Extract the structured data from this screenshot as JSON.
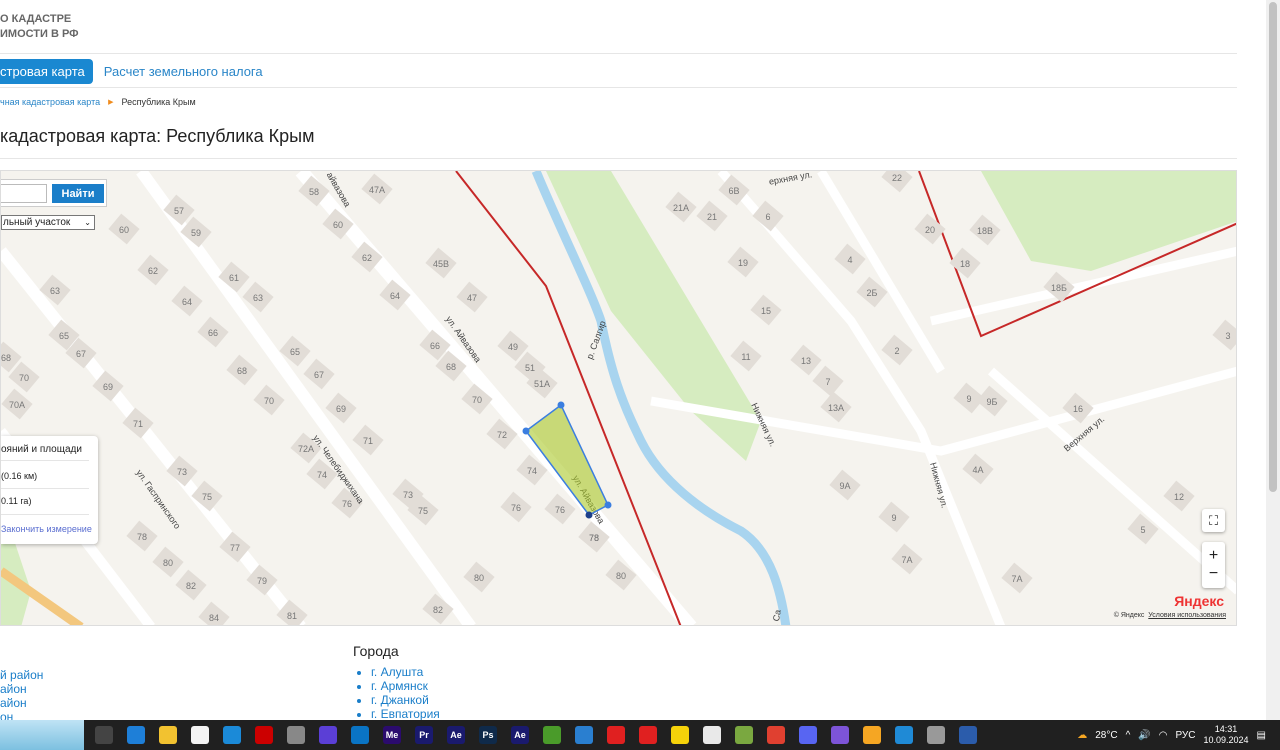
{
  "header": {
    "logo_line1": "О КАДАСТРЕ",
    "logo_line2": "ИМОСТИ В РФ"
  },
  "nav": {
    "active": "стровая карта",
    "tax": "Расчет земельного налога"
  },
  "breadcrumb": {
    "parent": "чная кадастровая карта",
    "current": "Республика Крым"
  },
  "page_title": "кадастровая карта: Республика Крым",
  "map": {
    "search_button": "Найти",
    "search_value": "",
    "type_select": "льный участок",
    "measure": {
      "title": "ояний и площади",
      "distance": "(0.16 км)",
      "area": "0.11 га)",
      "finish": "Закончить измерение"
    },
    "fullscreen": "⛶",
    "zoom_in": "+",
    "zoom_out": "−",
    "copyright": "© Яндекс",
    "terms": "Условия использования",
    "brand": "Яндекс",
    "streets": [
      "ул. Айвазова",
      "ул. Челебиджихана",
      "ул. Гаспринского",
      "Нижняя ул.",
      "Нижняя ул.",
      "Верхняя ул.",
      "ерхняя ул.",
      "р. Салгир",
      "ул. Айвазова",
      "р. Са",
      "айвазова"
    ],
    "buildings": [
      "57",
      "59",
      "60",
      "62",
      "63",
      "61",
      "63",
      "64",
      "66",
      "68",
      "65",
      "67",
      "69",
      "70",
      "71",
      "68",
      "70",
      "70А",
      "65",
      "67",
      "69",
      "71",
      "72А",
      "74",
      "76",
      "73",
      "75",
      "77",
      "78",
      "80",
      "79",
      "81",
      "82",
      "84",
      "73",
      "75",
      "76",
      "78",
      "80",
      "82",
      "58",
      "47А",
      "60",
      "62",
      "64",
      "45В",
      "47",
      "66",
      "68",
      "70",
      "72",
      "74",
      "76",
      "49",
      "51",
      "51А",
      "78",
      "80",
      "21А",
      "21",
      "6В",
      "6",
      "19",
      "15",
      "11",
      "13",
      "4",
      "2Б",
      "2",
      "7",
      "13А",
      "9",
      "9Б",
      "16",
      "22",
      "20",
      "18В",
      "18",
      "18Б",
      "9А",
      "9",
      "4А",
      "12",
      "5",
      "7А",
      "7А",
      "3"
    ]
  },
  "footer": {
    "districts": [
      "й район",
      "айон",
      "айон",
      "он"
    ],
    "cities_title": "Города",
    "cities": [
      "г. Алушта",
      "г. Армянск",
      "г. Джанкой",
      "г. Евпатория"
    ]
  },
  "taskbar": {
    "weather": "28°C",
    "lang": "РУС",
    "time": "14:31",
    "date": "10.09.2024",
    "apps": [
      "task-view",
      "edge",
      "explorer",
      "store",
      "mail",
      "s-app",
      "cloud",
      "vpn",
      "screen",
      "Me",
      "Pr",
      "Ae",
      "Ps",
      "Ae",
      "utorrent",
      "defender",
      "opera",
      "yandex",
      "beeline",
      "yandex-browser",
      "photos",
      "anydesk",
      "discord",
      "drop",
      "mail2",
      "remote",
      "network",
      "Word"
    ]
  }
}
